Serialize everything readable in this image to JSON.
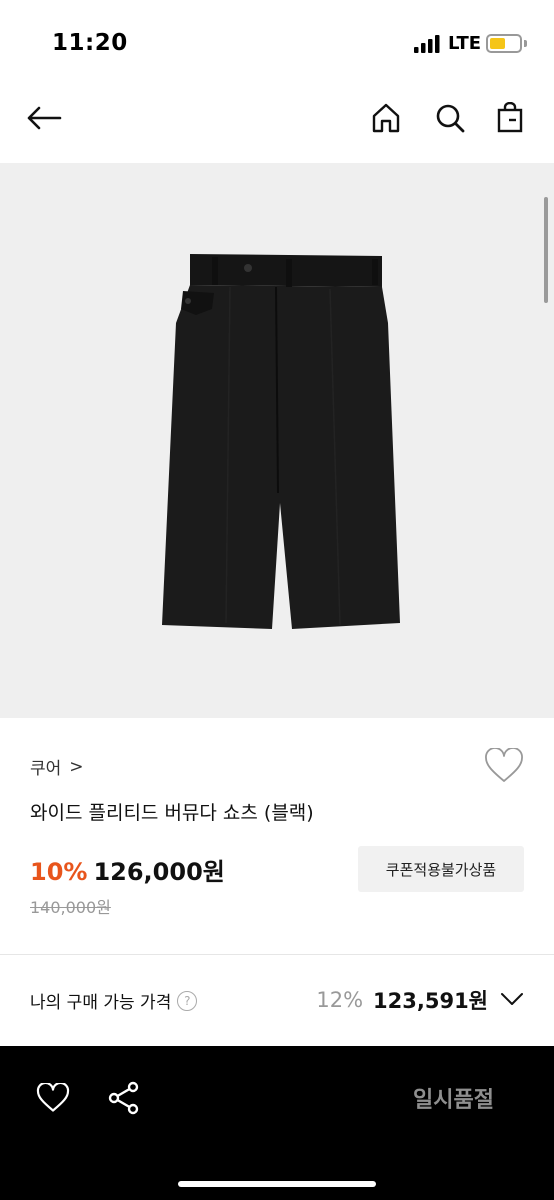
{
  "status_bar": {
    "time": "11:20",
    "network": "LTE",
    "battery_level": 0.55,
    "battery_color": "#f5c518"
  },
  "nav": {
    "back_icon": "arrow-left-icon",
    "home_icon": "home-icon",
    "search_icon": "search-icon",
    "bag_icon": "shopping-bag-icon"
  },
  "product": {
    "image_icon": "black-bermuda-shorts",
    "brand": "쿠어",
    "brand_chevron": ">",
    "title": "와이드 플리티드 버뮤다 쇼츠 (블랙)",
    "discount_rate": "10%",
    "price": "126,000원",
    "original_price": "140,000원",
    "coupon_badge": "쿠폰적용불가상품",
    "wish_icon": "heart-outline-icon"
  },
  "my_price": {
    "label": "나의 구매 가능 가격",
    "help": "?",
    "discount_rate": "12%",
    "amount": "123,591원"
  },
  "bottom_bar": {
    "wish_icon": "heart-outline-icon",
    "share_icon": "share-icon",
    "action_label": "일시품절"
  },
  "colors": {
    "accent": "#e8551c",
    "bottom_bar_bg": "#000000",
    "image_bg": "#efefef"
  }
}
